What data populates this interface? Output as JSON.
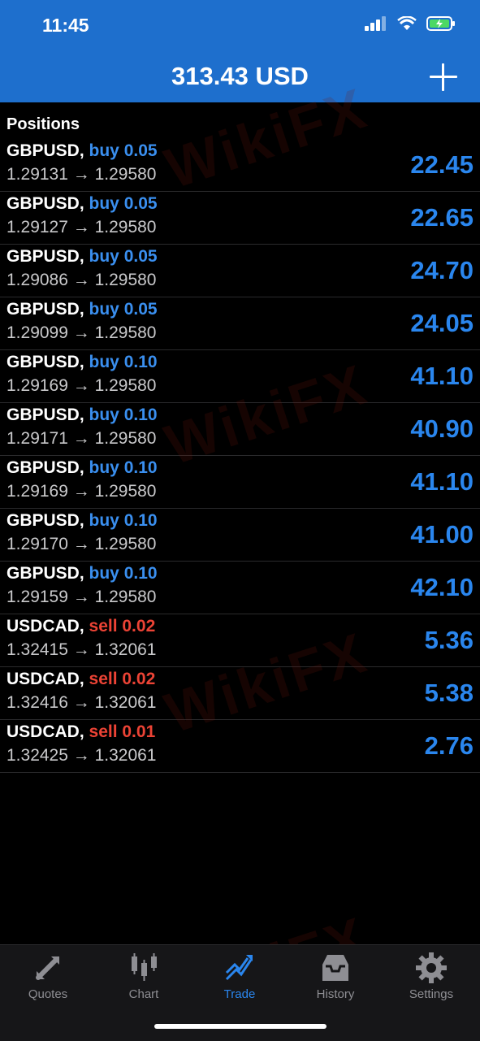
{
  "status": {
    "time": "11:45"
  },
  "header": {
    "title": "313.43 USD"
  },
  "section": {
    "title": "Positions"
  },
  "positions": [
    {
      "symbol": "GBPUSD,",
      "side": "buy 0.05",
      "prices": "1.29131 → 1.29580",
      "profit": "22.45"
    },
    {
      "symbol": "GBPUSD,",
      "side": "buy 0.05",
      "prices": "1.29127 → 1.29580",
      "profit": "22.65"
    },
    {
      "symbol": "GBPUSD,",
      "side": "buy 0.05",
      "prices": "1.29086 → 1.29580",
      "profit": "24.70"
    },
    {
      "symbol": "GBPUSD,",
      "side": "buy 0.05",
      "prices": "1.29099 → 1.29580",
      "profit": "24.05"
    },
    {
      "symbol": "GBPUSD,",
      "side": "buy 0.10",
      "prices": "1.29169 → 1.29580",
      "profit": "41.10"
    },
    {
      "symbol": "GBPUSD,",
      "side": "buy 0.10",
      "prices": "1.29171 → 1.29580",
      "profit": "40.90"
    },
    {
      "symbol": "GBPUSD,",
      "side": "buy 0.10",
      "prices": "1.29169 → 1.29580",
      "profit": "41.10"
    },
    {
      "symbol": "GBPUSD,",
      "side": "buy 0.10",
      "prices": "1.29170 → 1.29580",
      "profit": "41.00"
    },
    {
      "symbol": "GBPUSD,",
      "side": "buy 0.10",
      "prices": "1.29159 → 1.29580",
      "profit": "42.10"
    },
    {
      "symbol": "USDCAD,",
      "side": "sell 0.02",
      "prices": "1.32415 → 1.32061",
      "profit": "5.36"
    },
    {
      "symbol": "USDCAD,",
      "side": "sell 0.02",
      "prices": "1.32416 → 1.32061",
      "profit": "5.38"
    },
    {
      "symbol": "USDCAD,",
      "side": "sell 0.01",
      "prices": "1.32425 → 1.32061",
      "profit": "2.76"
    }
  ],
  "tabs": [
    {
      "label": "Quotes",
      "icon": "quotes-icon"
    },
    {
      "label": "Chart",
      "icon": "chart-icon"
    },
    {
      "label": "Trade",
      "icon": "trade-icon",
      "active": true
    },
    {
      "label": "History",
      "icon": "history-icon"
    },
    {
      "label": "Settings",
      "icon": "settings-icon"
    }
  ],
  "watermark": {
    "text": "WikiFX"
  },
  "colors": {
    "header": "#1e6fcd",
    "buy": "#3a8fef",
    "sell": "#ec4335",
    "profit": "#2a86ee"
  }
}
